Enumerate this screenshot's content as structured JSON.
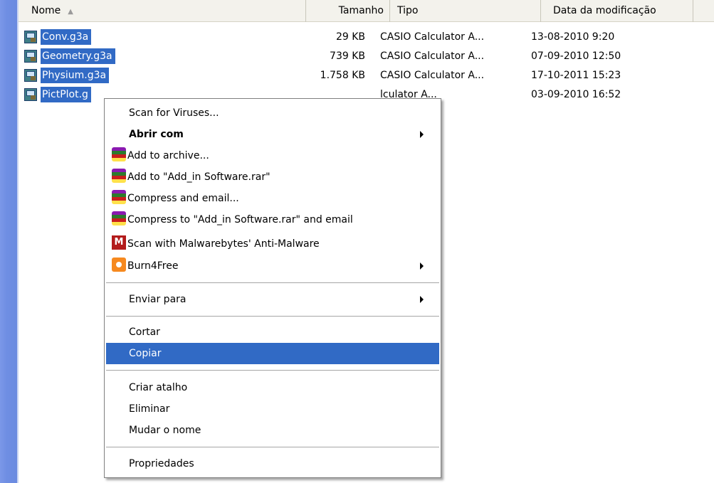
{
  "header": {
    "col_name": "Nome",
    "col_size": "Tamanho",
    "col_type": "Tipo",
    "col_date": "Data da modificação",
    "sort_icon": "sort-ascending-icon"
  },
  "files": [
    {
      "name": "Conv.g3a",
      "size": "29 KB",
      "type": "CASIO Calculator A...",
      "date": "13-08-2010 9:20"
    },
    {
      "name": "Geometry.g3a",
      "size": "739 KB",
      "type": "CASIO Calculator A...",
      "date": "07-09-2010 12:50"
    },
    {
      "name": "Physium.g3a",
      "size": "1.758 KB",
      "type": "CASIO Calculator A...",
      "date": "17-10-2011 15:23"
    },
    {
      "name": "PictPlot.g",
      "size": "",
      "type": "lculator A...",
      "date": "03-09-2010 16:52"
    }
  ],
  "menu": {
    "scan_viruses": "Scan for Viruses...",
    "abrir_com": "Abrir com",
    "add_archive": "Add to archive...",
    "add_to_rar": "Add to \"Add_in Software.rar\"",
    "compress_email": "Compress and email...",
    "compress_to_rar_email": "Compress to \"Add_in Software.rar\" and email",
    "scan_malwarebytes": "Scan with Malwarebytes' Anti-Malware",
    "malwarebytes_glyph": "M",
    "burn4free": "Burn4Free",
    "enviar_para": "Enviar para",
    "cortar": "Cortar",
    "copiar": "Copiar",
    "criar_atalho": "Criar atalho",
    "eliminar": "Eliminar",
    "mudar_nome": "Mudar o nome",
    "propriedades": "Propriedades"
  },
  "colors": {
    "selection": "#316ac5",
    "left_strip": "#6f8ee3",
    "header_bg": "#f3f2ec"
  }
}
